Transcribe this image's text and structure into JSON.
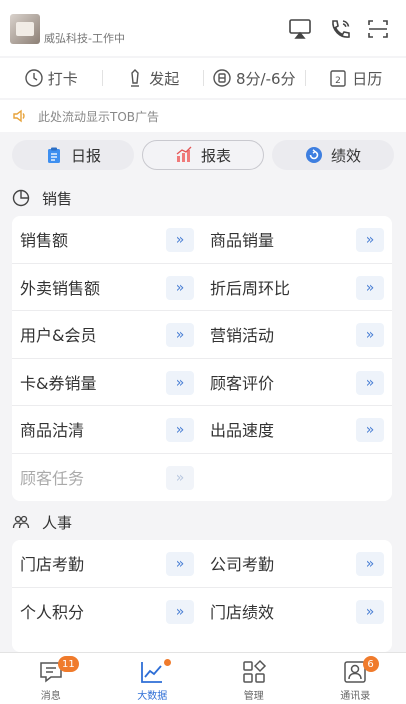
{
  "header": {
    "company": "威弘科技-工作中"
  },
  "quick_actions": [
    {
      "label": "打卡",
      "icon": "clock-icon"
    },
    {
      "label": "发起",
      "icon": "pen-icon"
    },
    {
      "label": "8分/-6分",
      "icon": "points-icon"
    },
    {
      "label": "日历",
      "icon": "calendar-icon"
    }
  ],
  "notice": {
    "text": "此处流动显示TOB广告"
  },
  "tabs": [
    {
      "label": "日报",
      "icon": "clipboard-icon"
    },
    {
      "label": "报表",
      "icon": "bar-chart-icon",
      "active": true
    },
    {
      "label": "绩效",
      "icon": "refresh-icon"
    }
  ],
  "sales": {
    "title": "销售",
    "rows": [
      [
        "销售额",
        "商品销量"
      ],
      [
        "外卖销售额",
        "折后周环比"
      ],
      [
        "用户&会员",
        "营销活动"
      ],
      [
        "卡&券销量",
        "顾客评价"
      ],
      [
        "商品沽清",
        "出品速度"
      ],
      [
        "顾客任务",
        ""
      ]
    ]
  },
  "hr": {
    "title": "人事",
    "rows": [
      [
        "门店考勤",
        "公司考勤"
      ],
      [
        "个人积分",
        "门店绩效"
      ]
    ]
  },
  "arrow_glyph": "»",
  "bottom_nav": [
    {
      "label": "消息",
      "icon": "message-icon",
      "badge": "11"
    },
    {
      "label": "大数据",
      "icon": "trend-icon",
      "active": true
    },
    {
      "label": "管理",
      "icon": "apps-icon"
    },
    {
      "label": "通讯录",
      "icon": "contacts-icon",
      "badge": "6"
    }
  ],
  "colors": {
    "accent": "#2f6fd6",
    "badge": "#f07b2c",
    "arrow": "#4a7fd4"
  }
}
